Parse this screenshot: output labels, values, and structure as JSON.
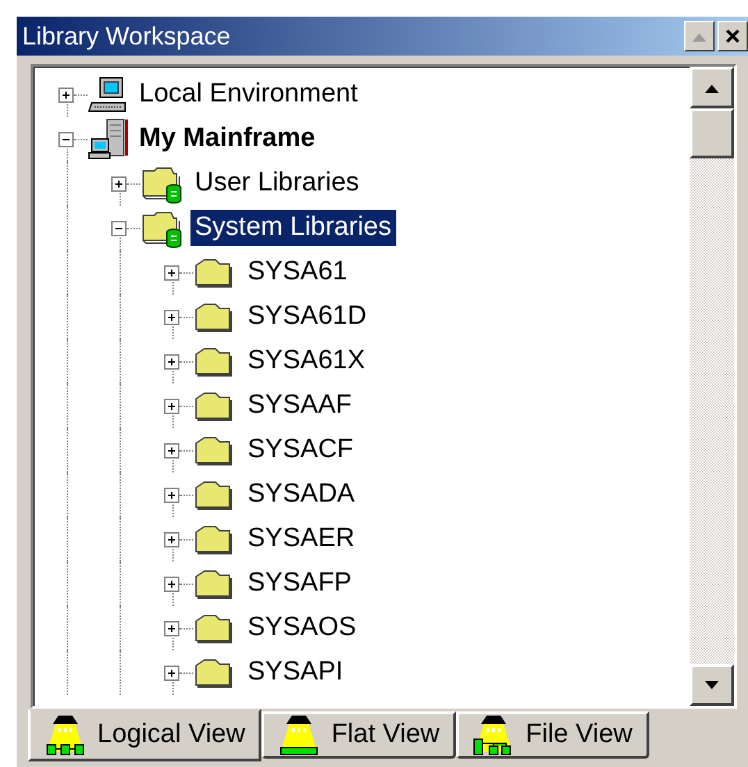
{
  "window": {
    "title": "Library Workspace"
  },
  "tree": [
    {
      "label": "Local Environment",
      "kind": "computer",
      "expanded": false,
      "selected": false,
      "bold": false
    },
    {
      "label": "My Mainframe",
      "kind": "mainframe",
      "expanded": true,
      "selected": false,
      "bold": true,
      "children": [
        {
          "label": "User Libraries",
          "kind": "library",
          "expanded": false,
          "selected": false,
          "bold": false
        },
        {
          "label": "System Libraries",
          "kind": "library",
          "expanded": true,
          "selected": true,
          "bold": false,
          "children": [
            {
              "label": "SYSA61",
              "kind": "folder",
              "expanded": false,
              "selected": false,
              "bold": false
            },
            {
              "label": "SYSA61D",
              "kind": "folder",
              "expanded": false,
              "selected": false,
              "bold": false
            },
            {
              "label": "SYSA61X",
              "kind": "folder",
              "expanded": false,
              "selected": false,
              "bold": false
            },
            {
              "label": "SYSAAF",
              "kind": "folder",
              "expanded": false,
              "selected": false,
              "bold": false
            },
            {
              "label": "SYSACF",
              "kind": "folder",
              "expanded": false,
              "selected": false,
              "bold": false
            },
            {
              "label": "SYSADA",
              "kind": "folder",
              "expanded": false,
              "selected": false,
              "bold": false
            },
            {
              "label": "SYSAER",
              "kind": "folder",
              "expanded": false,
              "selected": false,
              "bold": false
            },
            {
              "label": "SYSAFP",
              "kind": "folder",
              "expanded": false,
              "selected": false,
              "bold": false
            },
            {
              "label": "SYSAOS",
              "kind": "folder",
              "expanded": false,
              "selected": false,
              "bold": false
            },
            {
              "label": "SYSAPI",
              "kind": "folder",
              "expanded": false,
              "selected": false,
              "bold": false
            }
          ]
        }
      ]
    }
  ],
  "tabs": [
    {
      "label": "Logical View",
      "kind": "logical",
      "selected": true
    },
    {
      "label": "Flat View",
      "kind": "flat",
      "selected": false
    },
    {
      "label": "File View",
      "kind": "file",
      "selected": false
    }
  ]
}
